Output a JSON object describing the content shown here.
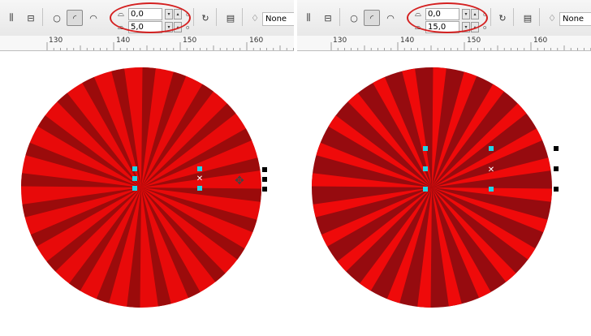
{
  "panels": [
    {
      "id": "left",
      "corner_radius_top": "0,0",
      "corner_radius_bottom": "5,0",
      "outline": "None",
      "ruler_labels": [
        "130",
        "140",
        "150",
        "160"
      ],
      "colors": {
        "base": "#e80a0a",
        "rays": "#9b0b0b"
      }
    },
    {
      "id": "right",
      "corner_radius_top": "0,0",
      "corner_radius_bottom": "15,0",
      "outline": "None",
      "ruler_labels": [
        "130",
        "140",
        "150",
        "160"
      ],
      "colors": {
        "base": "#960b0f",
        "rays": "#ef0a0a"
      }
    }
  ],
  "colors": {
    "highlight_ellipse": "#d42020",
    "node_cyan": "#22d4e6",
    "handle_black": "#000000"
  }
}
